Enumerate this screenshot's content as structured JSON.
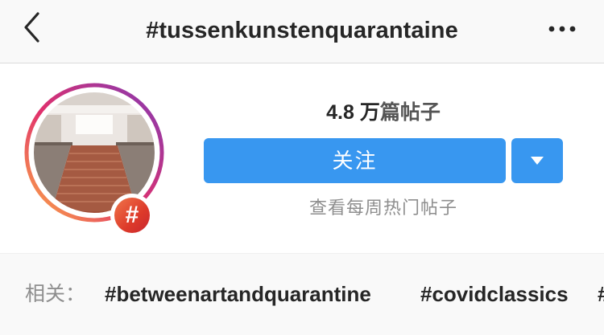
{
  "header": {
    "title": "#tussenkunstenquarantaine",
    "back_icon": "chevron-left-icon",
    "more_icon": "more-horizontal-icon"
  },
  "profile": {
    "post_count_number": "4.8",
    "post_count_unit": "万",
    "post_count_label": "篇帖子",
    "follow_label": "关注",
    "dropdown_icon": "caret-down-icon",
    "weekly_link": "查看每周热门帖子",
    "badge_symbol": "#",
    "avatar_icon": "hashtag-avatar-photo"
  },
  "related": {
    "label": "相关：",
    "tags": [
      "#betweenartandquarantine",
      "#covidclassics",
      "#"
    ]
  },
  "colors": {
    "accent": "#3897f0",
    "text": "#262626",
    "muted": "#8e8e8e",
    "ring_start": "#fcaf45",
    "ring_mid": "#e1306c",
    "ring_end": "#833ab4"
  }
}
